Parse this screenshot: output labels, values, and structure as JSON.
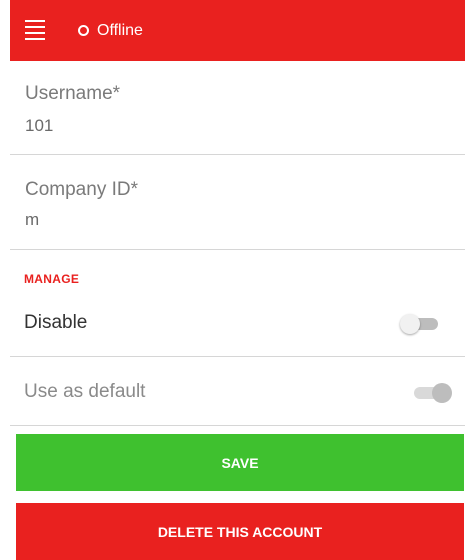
{
  "topbar": {
    "status_text": "Offline",
    "icons": [
      "hamburger-menu-icon",
      "offline-status-icon"
    ],
    "background_color": "#e9211f"
  },
  "form": {
    "username": {
      "label": "Username*",
      "value": "101"
    },
    "company_id": {
      "label": "Company ID*",
      "value": "m"
    }
  },
  "manage": {
    "section_title": "MANAGE",
    "disable": {
      "label": "Disable",
      "enabled": true,
      "state": "off"
    },
    "use_as_default": {
      "label": "Use as default",
      "enabled": false,
      "state": "on"
    }
  },
  "buttons": {
    "save_label": "SAVE",
    "save_color": "#3fc12f",
    "delete_label": "DELETE THIS ACCOUNT",
    "delete_color": "#e9211f"
  }
}
